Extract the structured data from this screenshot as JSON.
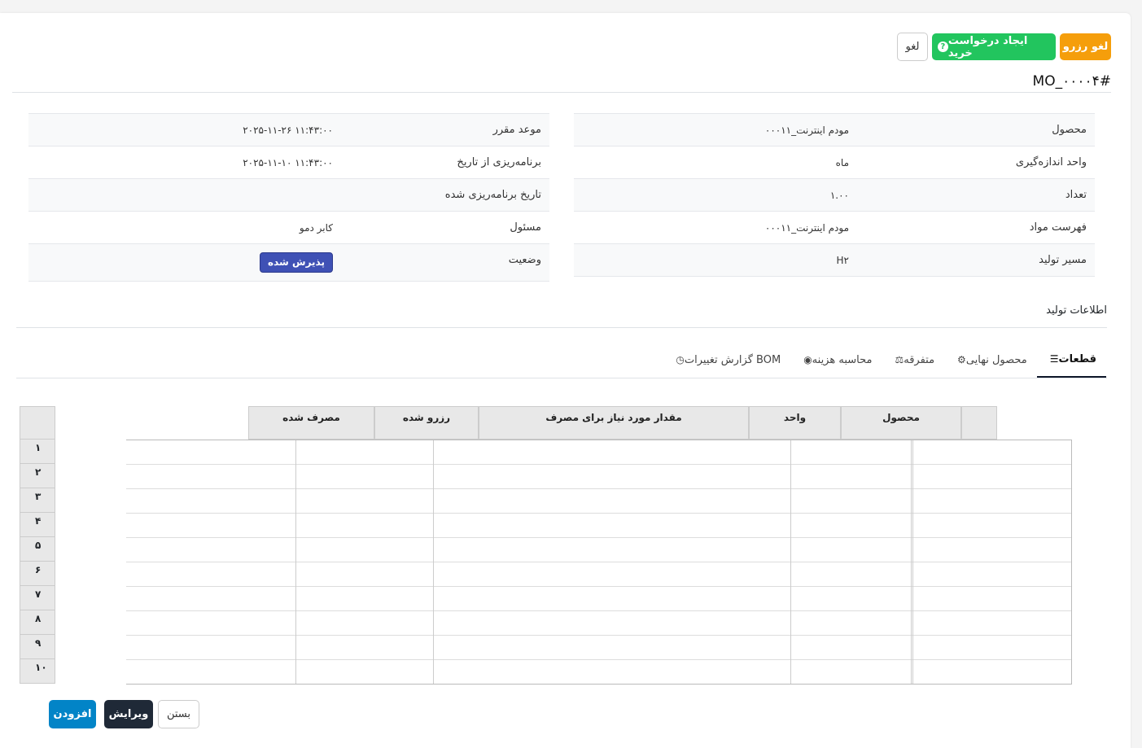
{
  "header": {
    "cancel_reserve": "لغو رزرو",
    "create_purchase": "ایجاد درخواست خرید",
    "cancel": "لغو",
    "order_title": "MO_۰۰۰۰۴#"
  },
  "details_right": [
    {
      "label": "محصول",
      "value": "۰۰۰۱۱_مودم اینترنت"
    },
    {
      "label": "واحد اندازه‌گیری",
      "value": "ماه"
    },
    {
      "label": "تعداد",
      "value": "۱.۰۰"
    },
    {
      "label": "فهرست مواد",
      "value": "۰۰۰۱۱_مودم اینترنت"
    },
    {
      "label": "مسیر تولید",
      "value": "H۲"
    }
  ],
  "details_left": [
    {
      "label": "موعد مقرر",
      "value": "۲۰۲۵-۱۱-۲۶ ۱۱:۴۳:۰۰"
    },
    {
      "label": "برنامه‌ریزی از تاریخ",
      "value": "۲۰۲۵-۱۱-۱۰ ۱۱:۴۳:۰۰"
    },
    {
      "label": "تاریخ برنامه‌ریزی شده",
      "value": ""
    },
    {
      "label": "مسئول",
      "value": "کابر دمو"
    },
    {
      "label": "وضعیت",
      "value": "پذیرش شده"
    }
  ],
  "section_title": "اطلاعات تولید",
  "tabs": [
    {
      "label": "قطعات",
      "icon": "list-icon"
    },
    {
      "label": "محصول نهایی",
      "icon": "gears-icon"
    },
    {
      "label": "متفرقه",
      "icon": "scale-icon"
    },
    {
      "label": "محاسبه هزینه",
      "icon": "coins-icon"
    },
    {
      "label": "گزارش تغییرات BOM",
      "icon": "clock-icon"
    }
  ],
  "grid": {
    "columns": [
      "محصول",
      "واحد",
      "مقدار مورد نیاز برای مصرف",
      "رزرو شده",
      "مصرف شده"
    ],
    "row_numbers": [
      "۱",
      "۲",
      "۳",
      "۴",
      "۵",
      "۶",
      "۷",
      "۸",
      "۹",
      "۱۰"
    ]
  },
  "footer": {
    "close": "بستن",
    "edit": "ویرایش",
    "add": "افزودن"
  }
}
